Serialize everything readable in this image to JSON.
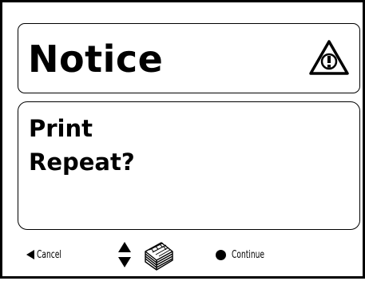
{
  "dialog": {
    "title": "Notice",
    "message_lines": [
      "Print",
      "Repeat?"
    ]
  },
  "footer": {
    "cancel_label": "Cancel",
    "continue_label": "Continue"
  },
  "icons": {
    "title_icon": "warning-icon",
    "nav_icon": "up-down-arrows-icon",
    "stack_icon": "paper-stack-icon",
    "cancel_icon": "left-arrow-icon",
    "continue_icon": "filled-circle-icon"
  }
}
